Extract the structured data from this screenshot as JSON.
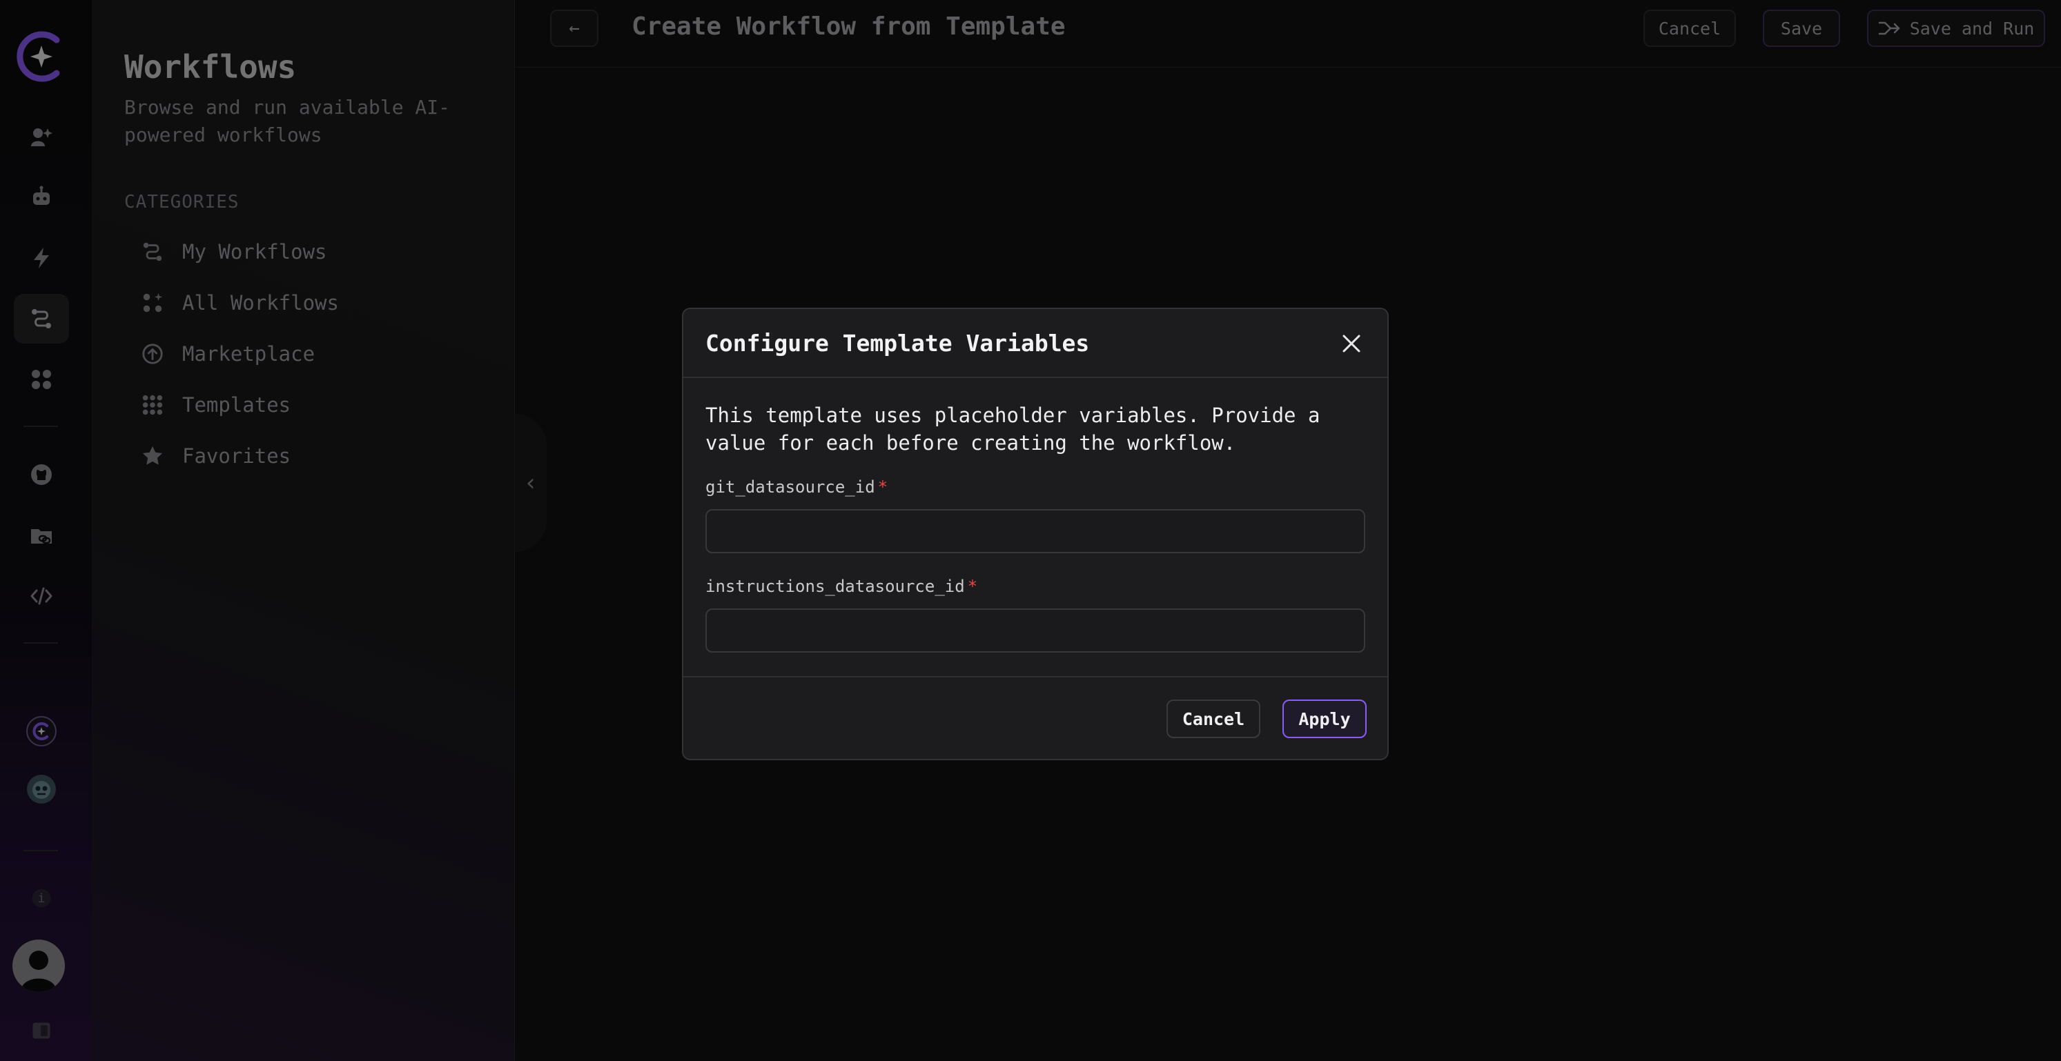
{
  "rail": {
    "items": [
      {
        "icon": "assistant-icon",
        "active": false
      },
      {
        "icon": "robot-icon",
        "active": false
      },
      {
        "icon": "lightning-icon",
        "active": false
      },
      {
        "icon": "workflow-icon",
        "active": true
      },
      {
        "icon": "apps-grid-icon",
        "active": false
      },
      {
        "icon": "github-icon",
        "active": false
      },
      {
        "icon": "folder-link-icon",
        "active": false
      },
      {
        "icon": "code-icon",
        "active": false
      }
    ],
    "info_label": "i"
  },
  "sidebar": {
    "title": "Workflows",
    "subtitle": "Browse and run available AI-powered workflows",
    "categories_label": "CATEGORIES",
    "items": [
      {
        "label": "My Workflows",
        "icon": "workflow-icon"
      },
      {
        "label": "All Workflows",
        "icon": "all-workflows-icon"
      },
      {
        "label": "Marketplace",
        "icon": "upload-circle-icon"
      },
      {
        "label": "Templates",
        "icon": "grid-dots-icon"
      },
      {
        "label": "Favorites",
        "icon": "star-icon"
      }
    ]
  },
  "header": {
    "back_label": "←",
    "title": "Create Workflow from Template",
    "cancel_label": "Cancel",
    "save_label": "Save",
    "save_run_label": "Save and Run"
  },
  "modal": {
    "title": "Configure Template Variables",
    "description": "This template uses placeholder variables. Provide a value for each before creating the workflow.",
    "fields": [
      {
        "label": "git_datasource_id",
        "required_mark": "*",
        "value": ""
      },
      {
        "label": "instructions_datasource_id",
        "required_mark": "*",
        "value": ""
      }
    ],
    "cancel_label": "Cancel",
    "apply_label": "Apply"
  },
  "colors": {
    "accent": "#8b5cf6",
    "required": "#ef4444",
    "background": "#111112"
  }
}
